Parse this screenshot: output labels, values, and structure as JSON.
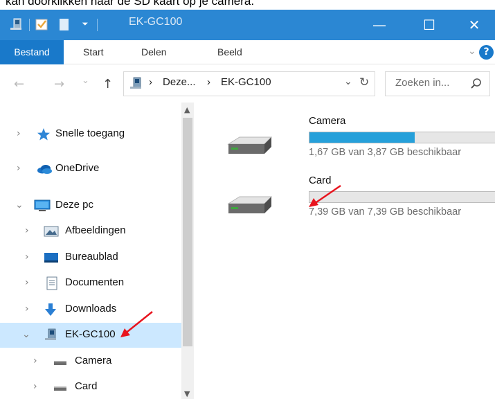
{
  "caption": "kan doorklikken naar de SD kaart op je camera.",
  "window": {
    "title": "EK-GC100",
    "controls": {
      "minimize": "—",
      "maximize": "☐",
      "close": "✕"
    }
  },
  "ribbon": {
    "tabs": [
      "Bestand",
      "Start",
      "Delen",
      "Beeld"
    ],
    "collapse_glyph": "⌄",
    "help_glyph": "?"
  },
  "address": {
    "back": "←",
    "forward": "→",
    "recent": "⌄",
    "up": "↑",
    "separator": "›",
    "crumbs": [
      "Deze...",
      "EK-GC100"
    ],
    "dropdown": "⌄",
    "refresh": "↻",
    "search_placeholder": "Zoeken in..."
  },
  "nav": {
    "items": [
      {
        "label": "Snelle toegang",
        "chevron": "›",
        "icon": "star-icon"
      },
      {
        "label": "OneDrive",
        "chevron": "›",
        "icon": "cloud-icon"
      },
      {
        "label": "Deze pc",
        "chevron": "⌄",
        "icon": "computer-icon"
      },
      {
        "label": "Afbeeldingen",
        "chevron": "›",
        "icon": "pictures-icon"
      },
      {
        "label": "Bureaublad",
        "chevron": "›",
        "icon": "desktop-icon"
      },
      {
        "label": "Documenten",
        "chevron": "›",
        "icon": "documents-icon"
      },
      {
        "label": "Downloads",
        "chevron": "›",
        "icon": "download-icon"
      },
      {
        "label": "EK-GC100",
        "chevron": "⌄",
        "icon": "device-icon",
        "selected": true
      },
      {
        "label": "Camera",
        "chevron": "›",
        "icon": "drive-icon"
      },
      {
        "label": "Card",
        "chevron": "›",
        "icon": "drive-icon"
      }
    ],
    "scroll_up": "▲",
    "scroll_down": "▼"
  },
  "drives": [
    {
      "name": "Camera",
      "used_fraction": 0.568,
      "free_text": "1,67 GB van 3,87 GB beschikbaar"
    },
    {
      "name": "Card",
      "used_fraction": 0.0,
      "free_text": "7,39 GB van 7,39 GB beschikbaar"
    }
  ],
  "colors": {
    "titlebar": "#2b87d3",
    "accent": "#1979ca",
    "selection": "#cce8ff",
    "bar_fill": "#26a0da",
    "annotation_arrow": "#e8141e"
  }
}
